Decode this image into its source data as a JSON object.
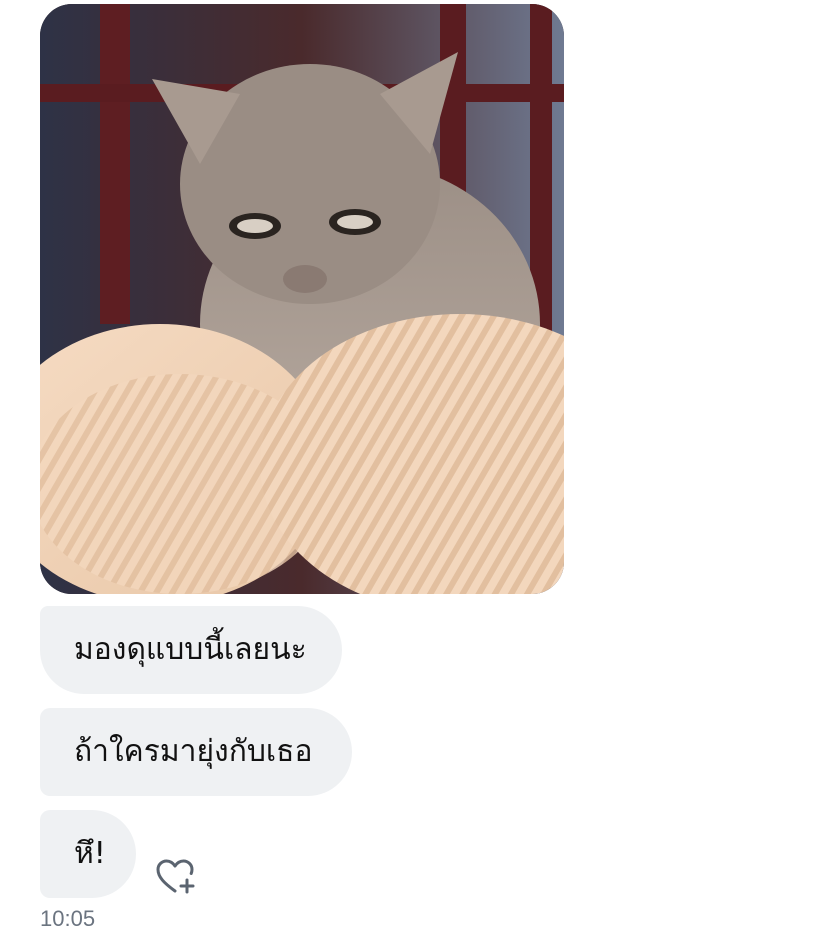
{
  "messages": [
    {
      "type": "image",
      "icon": "photo-cat-on-pillows"
    },
    {
      "type": "text",
      "text": "มองดุแบบนี้เลยนะ"
    },
    {
      "type": "text",
      "text": "ถ้าใครมายุ่งกับเธอ"
    },
    {
      "type": "text",
      "text": "หึ!"
    }
  ],
  "reaction_icon": "heart-plus-icon",
  "timestamp": "10:05",
  "colors": {
    "bubble_bg": "#eff1f3",
    "text": "#111111",
    "timestamp": "#6b7480",
    "icon": "#5b6470"
  }
}
